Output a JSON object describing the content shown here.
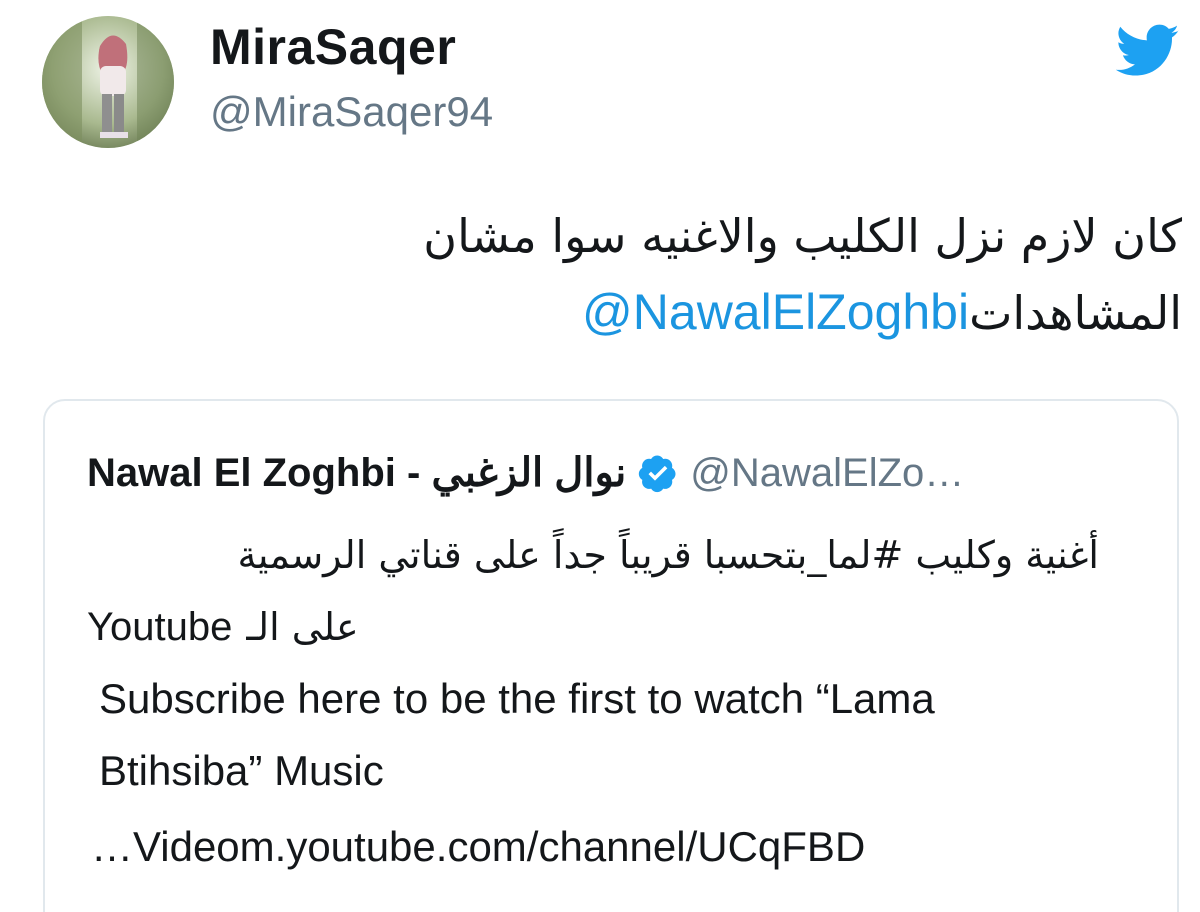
{
  "author": {
    "display_name": "MiraSaqer",
    "handle": "@MiraSaqer94",
    "avatar_icon": "profile-photo",
    "platform_icon": "twitter-bird-icon",
    "brand_color": "#1da1f2"
  },
  "tweet": {
    "line1": "كان لازم نزل الكليب والاغنيه سوا مشان",
    "line2_text": "المشاهدات",
    "line2_mention": "@NawalElZoghbi",
    "mention_color": "#1b95e0"
  },
  "quoted": {
    "name": "Nawal El Zoghbi - نوال الزغبي",
    "verified_icon": "verified-badge-icon",
    "handle": "@NawalElZo…",
    "arabic_line1": "أغنية وكليب #لما_بتحسبا قريباً جداً على قناتي الرسمية",
    "arabic_line2_prefix": "على الـ",
    "arabic_line2_suffix": "Youtube",
    "english_line1": "Subscribe here to be the first to watch “Lama",
    "english_line2": "Btihsiba” Music",
    "link": "…Videom.youtube.com/channel/UCqFBD"
  }
}
